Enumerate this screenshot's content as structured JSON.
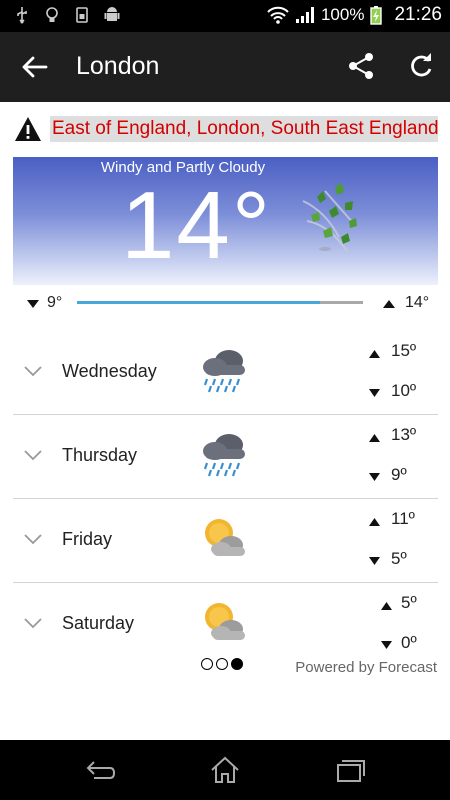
{
  "status_bar": {
    "left_icons": [
      "usb-icon",
      "lightbulb-icon",
      "sim-card-icon",
      "android-icon"
    ],
    "battery_percent": "100%",
    "time": "21:26"
  },
  "app_bar": {
    "title": "London",
    "icons": [
      "back-arrow-icon",
      "share-icon",
      "refresh-icon"
    ]
  },
  "alert": {
    "icon": "warning-icon",
    "text": "East of England, London, South East England"
  },
  "current": {
    "condition": "Windy and Partly Cloudy",
    "temperature": "14°",
    "icon": "windy-leaves-icon",
    "low": "9°",
    "high": "14°",
    "range_fill_fraction": 0.85
  },
  "forecast": [
    {
      "day": "Wednesday",
      "icon": "rain-cloud-icon",
      "high": "15º",
      "low": "10º"
    },
    {
      "day": "Thursday",
      "icon": "rain-cloud-icon",
      "high": "13º",
      "low": "9º"
    },
    {
      "day": "Friday",
      "icon": "partly-cloudy-icon",
      "high": "11º",
      "low": "5º"
    },
    {
      "day": "Saturday",
      "icon": "partly-cloudy-icon",
      "high": "5º",
      "low": "0º"
    }
  ],
  "pager": {
    "pages": 3,
    "active": 3
  },
  "powered_by": "Powered by Forecast",
  "nav_bar": {
    "icons": [
      "back-icon",
      "home-icon",
      "recents-icon"
    ]
  },
  "colors": {
    "alert_text": "#d40000",
    "range_fill": "#4aa7d9",
    "app_bar": "#1f1f1f"
  }
}
